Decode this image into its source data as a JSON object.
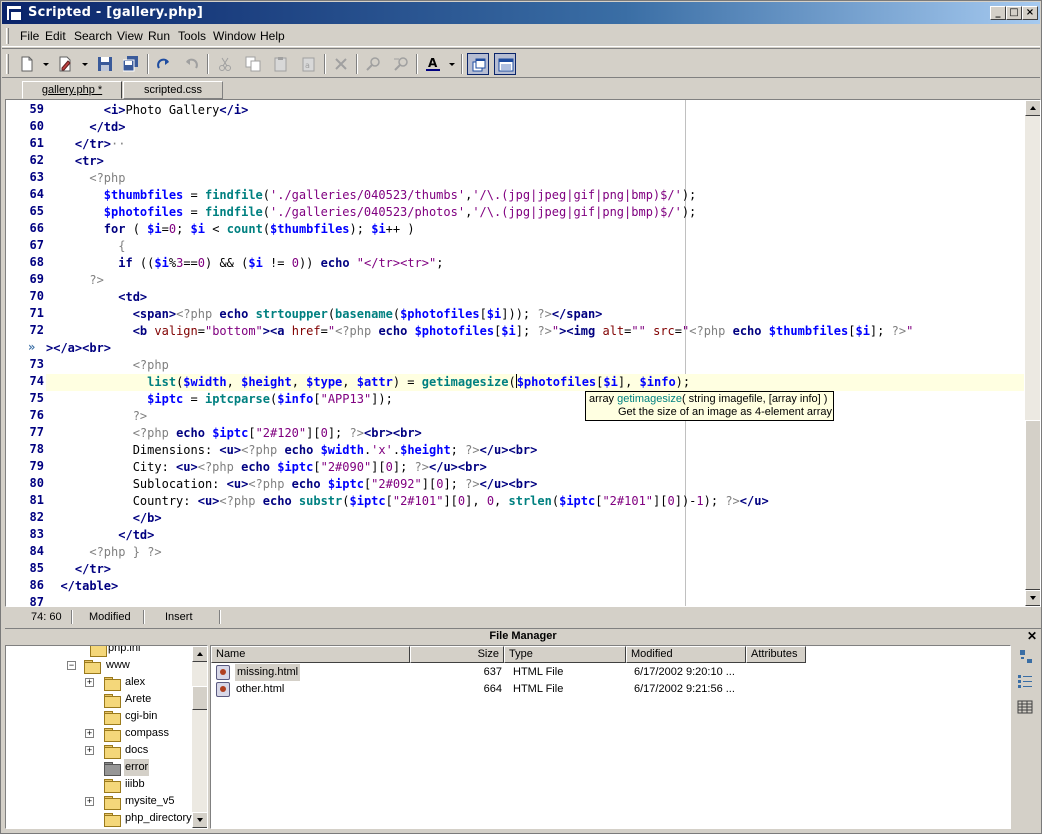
{
  "window": {
    "title": "Scripted - [gallery.php]"
  },
  "menu": [
    "File",
    "Edit",
    "Search",
    "View",
    "Run",
    "Tools",
    "Window",
    "Help"
  ],
  "toolbar": {
    "icons": [
      "new-file-icon",
      "edit-icon",
      "save-icon",
      "save-all-icon",
      "redo-icon",
      "undo-icon",
      "cut-icon",
      "copy-icon",
      "paste-icon",
      "paste-special-icon",
      "delete-icon",
      "find-icon",
      "replace-icon",
      "font-color-icon",
      "tile-windows-icon",
      "full-window-icon"
    ]
  },
  "tabs": [
    {
      "label": "gallery.php *",
      "active": true
    },
    {
      "label": "scripted.css",
      "active": false
    }
  ],
  "editor": {
    "line_numbers": [
      "59",
      "60",
      "61",
      "62",
      "63",
      "64",
      "65",
      "66",
      "67",
      "68",
      "69",
      "70",
      "71",
      "72",
      "",
      "73",
      "74",
      "75",
      "76",
      "77",
      "78",
      "79",
      "80",
      "81",
      "82",
      "83",
      "84",
      "85",
      "86",
      "87"
    ],
    "tooltip": {
      "prefix": "array",
      "function": "getimagesize",
      "signature": "( string imagefile, [array info] )",
      "description": "Get the size of an image as 4-element array"
    }
  },
  "status": {
    "position": "74: 60",
    "state": "Modified",
    "mode": "Insert"
  },
  "file_manager": {
    "title": "File Manager",
    "tree": [
      {
        "label": "php.ini",
        "level": 2,
        "expander": "",
        "folder": false
      },
      {
        "label": "www",
        "level": 1,
        "expander": "-",
        "folder": true
      },
      {
        "label": "alex",
        "level": 2,
        "expander": "+",
        "folder": true
      },
      {
        "label": "Arete",
        "level": 2,
        "expander": "",
        "folder": true
      },
      {
        "label": "cgi-bin",
        "level": 2,
        "expander": "",
        "folder": true
      },
      {
        "label": "compass",
        "level": 2,
        "expander": "+",
        "folder": true
      },
      {
        "label": "docs",
        "level": 2,
        "expander": "+",
        "folder": true
      },
      {
        "label": "error",
        "level": 2,
        "expander": "",
        "folder": true,
        "selected": true
      },
      {
        "label": "iiibb",
        "level": 2,
        "expander": "",
        "folder": true
      },
      {
        "label": "mysite_v5",
        "level": 2,
        "expander": "+",
        "folder": true
      },
      {
        "label": "php_directory",
        "level": 2,
        "expander": "",
        "folder": true
      }
    ],
    "columns": [
      "Name",
      "Size",
      "Type",
      "Modified",
      "Attributes"
    ],
    "files": [
      {
        "name": "missing.html",
        "size": "637",
        "type": "HTML File",
        "modified": "6/17/2002 9:20:10 ..."
      },
      {
        "name": "other.html",
        "size": "664",
        "type": "HTML File",
        "modified": "6/17/2002 9:21:56 ..."
      }
    ]
  }
}
